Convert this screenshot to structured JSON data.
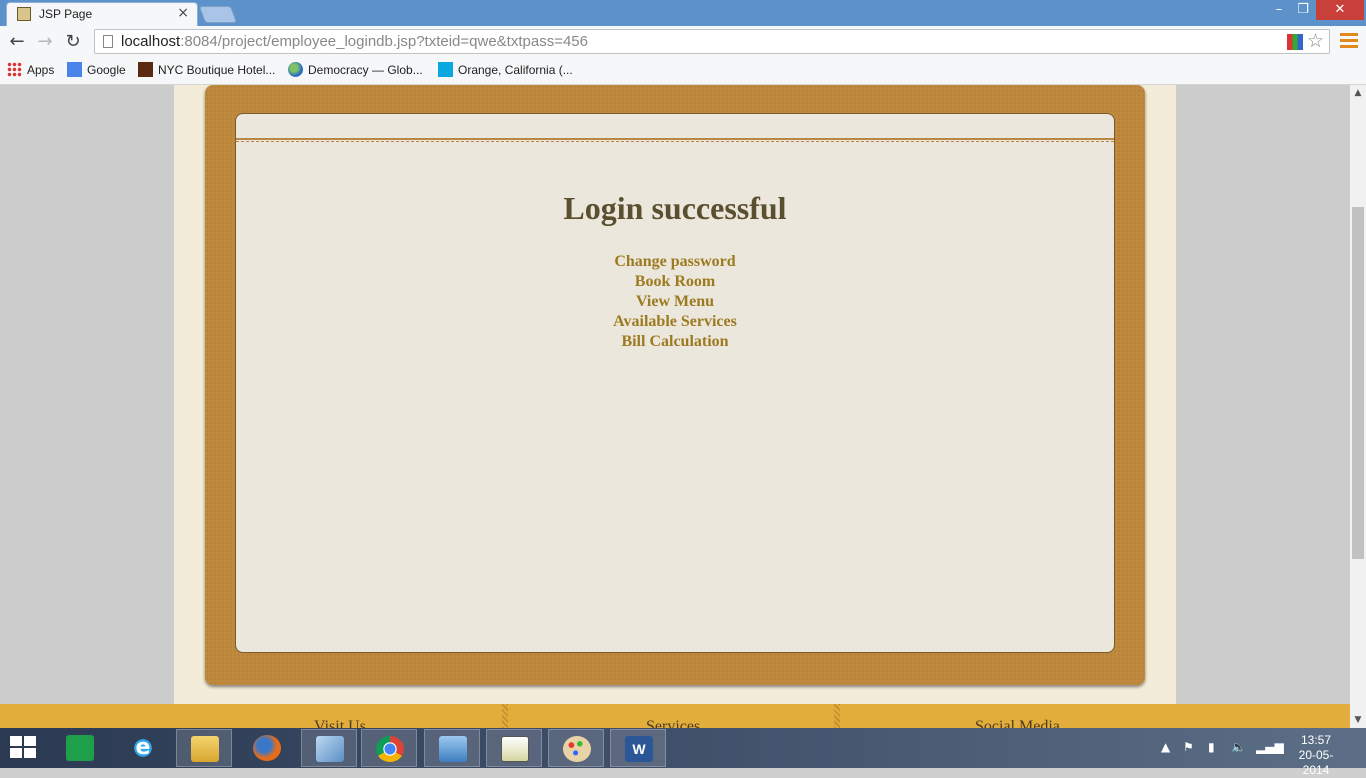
{
  "browser": {
    "tab_title": "JSP Page",
    "tab_close": "×",
    "window_controls": {
      "minimize": "–",
      "maximize": "❐",
      "close": "✕"
    },
    "url_host": "localhost",
    "url_rest": ":8084/project/employee_logindb.jsp?txteid=qwe&txtpass=456",
    "nav": {
      "back": "←",
      "forward": "→",
      "reload": "↻"
    },
    "star": "☆"
  },
  "bookmarks": [
    {
      "label": "Apps",
      "icon": "apps-grid-icon"
    },
    {
      "label": "Google",
      "icon": "google-icon"
    },
    {
      "label": "NYC Boutique Hotel...",
      "icon": "hc-icon"
    },
    {
      "label": "Democracy — Glob...",
      "icon": "globe-icon"
    },
    {
      "label": "Orange, California (...",
      "icon": "f-icon"
    }
  ],
  "page": {
    "heading": "Login successful",
    "menu": [
      "Change password",
      "Book Room",
      "View Menu",
      "Available Services",
      "Bill Calculation"
    ],
    "footer": {
      "headings": [
        "Visit Us",
        "Services",
        "Social Media"
      ]
    },
    "colors": {
      "board": "#bf893e",
      "card": "#ece7dc",
      "heading": "#5a4f2e",
      "link": "#9c7a1f",
      "footer": "#e3ad3b"
    }
  },
  "taskbar": {
    "icon_glyphs": {
      "ie": "e",
      "word": "W"
    },
    "time": "13:57",
    "date": "20-05-2014"
  }
}
